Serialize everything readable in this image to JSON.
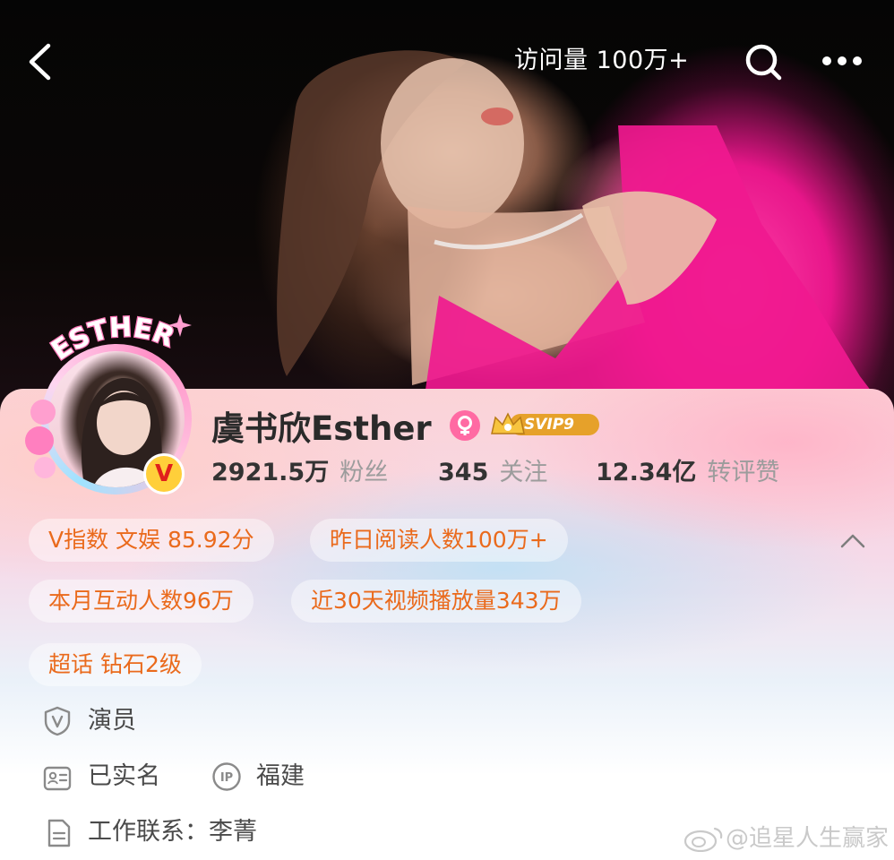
{
  "header": {
    "visits": "访问量 100万+",
    "icons": [
      "back-icon",
      "search-icon",
      "more-icon"
    ]
  },
  "profile": {
    "avatar_title": "ESTHER",
    "verified_letter": "V",
    "name": "虞书欣Esther",
    "svip_label": "SVIP9",
    "stats": [
      {
        "value": "2921.5万",
        "label": "粉丝"
      },
      {
        "value": "345",
        "label": "关注"
      },
      {
        "value": "12.34亿",
        "label": "转评赞"
      }
    ]
  },
  "tags": [
    "V指数 文娱 85.92分",
    "昨日阅读人数100万+",
    "本月互动人数96万",
    "近30天视频播放量343万",
    "超话 钻石2级"
  ],
  "info": {
    "occupation": "演员",
    "real_name": "已实名",
    "ip_label": "IP",
    "location": "福建",
    "contact": "工作联系：李菁"
  },
  "watermark": "@追星人生赢家",
  "colors": {
    "tag_text": "#ea6a1c",
    "gender_badge": "#ff6aa3",
    "verify_badge": "#ffcf3a"
  }
}
